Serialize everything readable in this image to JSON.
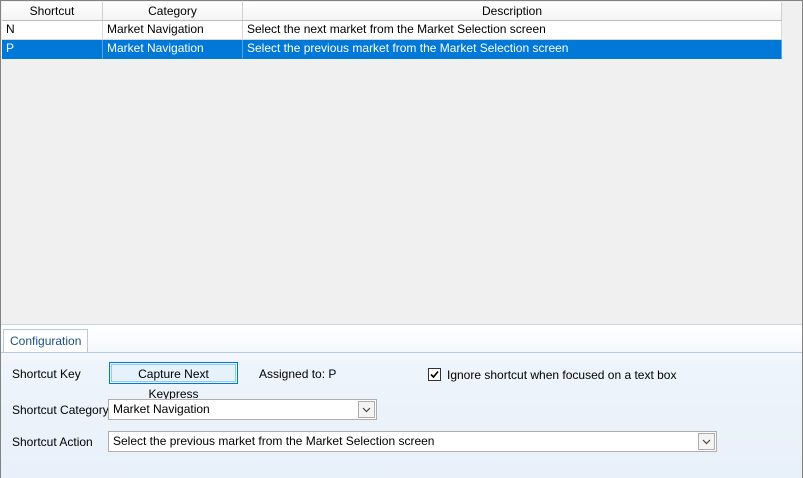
{
  "grid": {
    "columns": [
      "Shortcut",
      "Category",
      "Description"
    ],
    "rows": [
      {
        "shortcut": "N",
        "category": "Market Navigation",
        "description": "Select the next market from the Market Selection screen",
        "selected": false
      },
      {
        "shortcut": "P",
        "category": "Market Navigation",
        "description": "Select the previous market from the Market Selection screen",
        "selected": true
      }
    ]
  },
  "config": {
    "tab_label": "Configuration",
    "shortcut_key_label": "Shortcut Key",
    "capture_button_label": "Capture Next Keypress",
    "assigned_text": "Assigned to: P",
    "ignore_checkbox_label": "Ignore shortcut when focused on a text box",
    "ignore_checked": true,
    "category_label": "Shortcut Category",
    "category_value": "Market Navigation",
    "action_label": "Shortcut Action",
    "action_value": "Select the previous market from the Market Selection screen"
  },
  "colors": {
    "selection": "#0078d7",
    "tab_text": "#1a4f8a",
    "button_border": "#0078d7"
  },
  "icons": {
    "checkbox_mark": "checkmark-icon",
    "dropdown": "chevron-down-icon"
  }
}
